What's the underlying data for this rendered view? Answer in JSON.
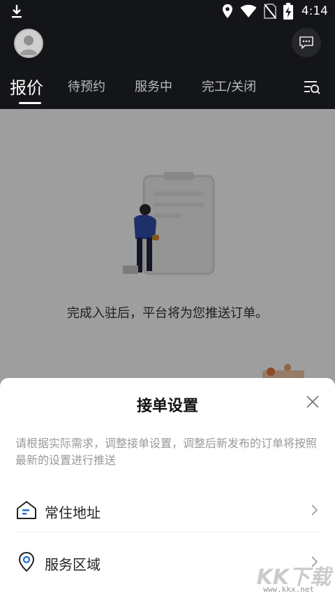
{
  "status_bar": {
    "time": "4:14",
    "icons": [
      "download-icon",
      "location-icon",
      "wifi-icon",
      "no-sim-icon",
      "battery-charging-icon"
    ]
  },
  "header": {
    "avatar": "avatar",
    "chat_icon": "chat-bubble-icon",
    "tabs": [
      {
        "label": "报价",
        "active": true
      },
      {
        "label": "待预约",
        "active": false
      },
      {
        "label": "服务中",
        "active": false
      },
      {
        "label": "完工/关闭",
        "active": false
      }
    ],
    "filter_icon": "filter-search-icon"
  },
  "content": {
    "empty_text": "完成入驻后，平台将为您推送订单。"
  },
  "sheet": {
    "title": "接单设置",
    "description": "请根据实际需求，调整接单设置，调整后新发布的订单将按照最新的设置进行推送",
    "rows": [
      {
        "label": "常住地址",
        "icon": "home-icon"
      },
      {
        "label": "服务区域",
        "icon": "map-pin-icon"
      }
    ]
  },
  "watermark": {
    "main": "KK下载",
    "sub": "www.kkx.net"
  },
  "colors": {
    "header_bg": "#141518",
    "accent": "#1f6fd6",
    "overlay": "rgba(0,0,0,0.38)"
  }
}
